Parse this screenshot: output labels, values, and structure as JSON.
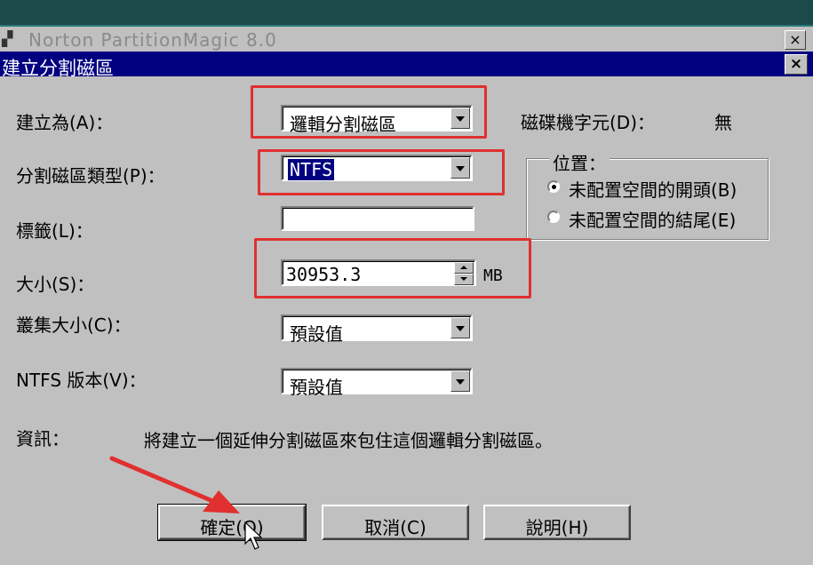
{
  "background_window": {
    "title": "Norton PartitionMagic 8.0",
    "close_glyph": "×"
  },
  "dialog": {
    "title": "建立分割磁區",
    "close_glyph": "×"
  },
  "form": {
    "create_as": {
      "label": "建立為(A)：",
      "value": "邏輯分割磁區"
    },
    "partition_type": {
      "label": "分割磁區類型(P)：",
      "value": "NTFS"
    },
    "volume_label": {
      "label": "標籤(L)：",
      "value": ""
    },
    "size": {
      "label": "大小(S)：",
      "value": "30953.3",
      "unit": "MB"
    },
    "cluster_size": {
      "label": "叢集大小(C)：",
      "value": "預設值"
    },
    "ntfs_version": {
      "label": "NTFS 版本(V)：",
      "value": "預設值"
    },
    "drive_letter": {
      "label": "磁碟機字元(D)：",
      "value": "無"
    }
  },
  "position_group": {
    "title": "位置：",
    "options": [
      {
        "label": "未配置空間的開頭(B)",
        "selected": true
      },
      {
        "label": "未配置空間的結尾(E)",
        "selected": false
      }
    ]
  },
  "info": {
    "label": "資訊：",
    "text": "將建立一個延伸分割磁區來包住這個邏輯分割磁區。"
  },
  "buttons": {
    "ok": "確定(O)",
    "cancel": "取消(C)",
    "help": "說明(H)"
  },
  "colors": {
    "titlebar": "#000080",
    "dialog_bg": "#c0c0c0",
    "highlight": "#e03030",
    "selection": "#000080"
  }
}
